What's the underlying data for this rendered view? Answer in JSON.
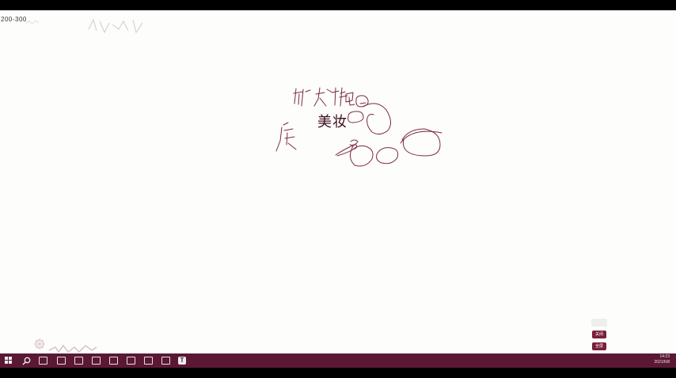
{
  "canvas": {
    "top_label": "200-300",
    "typed_text": "美妆"
  },
  "side_buttons": {
    "upper_label": "关闭",
    "lower_label": "全屏"
  },
  "taskbar": {
    "items": [
      {
        "icon": "windows-start-icon"
      },
      {
        "icon": "search-icon"
      },
      {
        "icon": "app-icon-1"
      },
      {
        "icon": "app-icon-2"
      },
      {
        "icon": "app-icon-3"
      },
      {
        "icon": "app-icon-4"
      },
      {
        "icon": "app-icon-5"
      },
      {
        "icon": "app-icon-6"
      },
      {
        "icon": "app-icon-7"
      },
      {
        "icon": "app-icon-8"
      },
      {
        "icon": "app-icon-9"
      },
      {
        "icon": "text-app-icon",
        "label": "T"
      }
    ],
    "time": "14:23",
    "date": "2021/6/8"
  },
  "colors": {
    "canvas_bg": "#fdfdfb",
    "taskbar_bg": "#5a1834",
    "ink": "#7a2a44",
    "button_bg": "#7a1f3a"
  }
}
